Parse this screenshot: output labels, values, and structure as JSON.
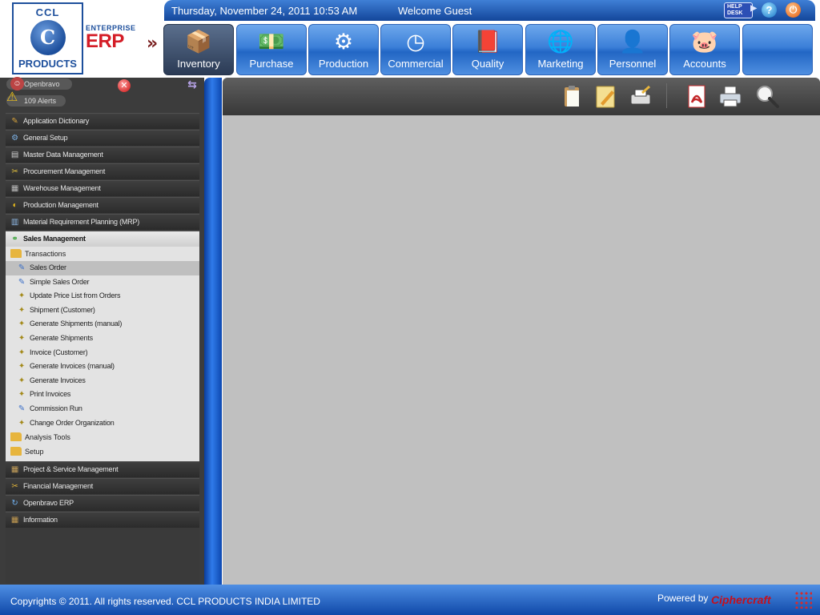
{
  "header": {
    "logo_top": "CCL",
    "logo_bottom": "PRODUCTS",
    "brand_small": "ENTERPRISE",
    "brand_big": "ERP",
    "datetime": "Thursday, November 24, 2011 10:53 AM",
    "welcome": "Welcome Guest",
    "help_desk_label": "HELP DESK",
    "help_icon": "question-mark-icon",
    "power_icon": "power-icon"
  },
  "modules": [
    {
      "label": "Inventory",
      "icon": "box-icon",
      "active": true
    },
    {
      "label": "Purchase",
      "icon": "money-icon",
      "active": false
    },
    {
      "label": "Production",
      "icon": "machine-icon",
      "active": false
    },
    {
      "label": "Commercial",
      "icon": "clock-icon",
      "active": false
    },
    {
      "label": "Quality",
      "icon": "book-icon",
      "active": false
    },
    {
      "label": "Marketing",
      "icon": "globe-people-icon",
      "active": false
    },
    {
      "label": "Personnel",
      "icon": "person-icon",
      "active": false
    },
    {
      "label": "Accounts",
      "icon": "piggy-bank-icon",
      "active": false
    },
    {
      "label": "",
      "icon": "",
      "active": false
    }
  ],
  "sidebar": {
    "user_label": "Openbravo",
    "alerts_label": "109 Alerts",
    "categories_before": [
      {
        "label": "Application Dictionary",
        "icon": "dictionary-icon"
      },
      {
        "label": "General Setup",
        "icon": "setup-icon"
      },
      {
        "label": "Master Data Management",
        "icon": "data-icon"
      },
      {
        "label": "Procurement Management",
        "icon": "procurement-icon"
      },
      {
        "label": "Warehouse Management",
        "icon": "warehouse-icon"
      },
      {
        "label": "Production Management",
        "icon": "production-icon"
      },
      {
        "label": "Material Requirement Planning (MRP)",
        "icon": "mrp-icon"
      }
    ],
    "open_category": {
      "label": "Sales Management",
      "icon": "sales-icon"
    },
    "transactions_folder": "Transactions",
    "transaction_items": [
      {
        "label": "Sales Order",
        "icon": "form-icon",
        "selected": true
      },
      {
        "label": "Simple Sales Order",
        "icon": "form-icon",
        "selected": false
      },
      {
        "label": "Update Price List from Orders",
        "icon": "process-icon",
        "selected": false
      },
      {
        "label": "Shipment (Customer)",
        "icon": "process-icon",
        "selected": false
      },
      {
        "label": "Generate Shipments (manual)",
        "icon": "process-icon",
        "selected": false
      },
      {
        "label": "Generate Shipments",
        "icon": "process-icon",
        "selected": false
      },
      {
        "label": "Invoice (Customer)",
        "icon": "process-icon",
        "selected": false
      },
      {
        "label": "Generate Invoices (manual)",
        "icon": "process-icon",
        "selected": false
      },
      {
        "label": "Generate Invoices",
        "icon": "process-icon",
        "selected": false
      },
      {
        "label": "Print Invoices",
        "icon": "process-icon",
        "selected": false
      },
      {
        "label": "Commission Run",
        "icon": "form-icon",
        "selected": false
      },
      {
        "label": "Change Order Organization",
        "icon": "process-icon",
        "selected": false
      }
    ],
    "other_folders": [
      {
        "label": "Analysis Tools"
      },
      {
        "label": "Setup"
      }
    ],
    "categories_after": [
      {
        "label": "Project & Service Management",
        "icon": "project-icon"
      },
      {
        "label": "Financial Management",
        "icon": "finance-icon"
      },
      {
        "label": "Openbravo ERP",
        "icon": "openbravo-icon"
      },
      {
        "label": "Information",
        "icon": "info-icon"
      }
    ]
  },
  "toolbar": {
    "buttons": [
      "clipboard-icon",
      "edit-note-icon",
      "print-preview-icon",
      "pdf-icon",
      "printer-icon",
      "search-icon"
    ]
  },
  "footer": {
    "copyright": "Copyrights © 2011. All rights reserved. CCL PRODUCTS INDIA LIMITED",
    "powered_by": "Powered by",
    "brand": "Ciphercraft"
  },
  "colors": {
    "accent_blue": "#1d4f9c",
    "tab_blue": "#3b7fd8",
    "erp_red": "#d41d27",
    "content_gray": "#c0c0c0"
  }
}
